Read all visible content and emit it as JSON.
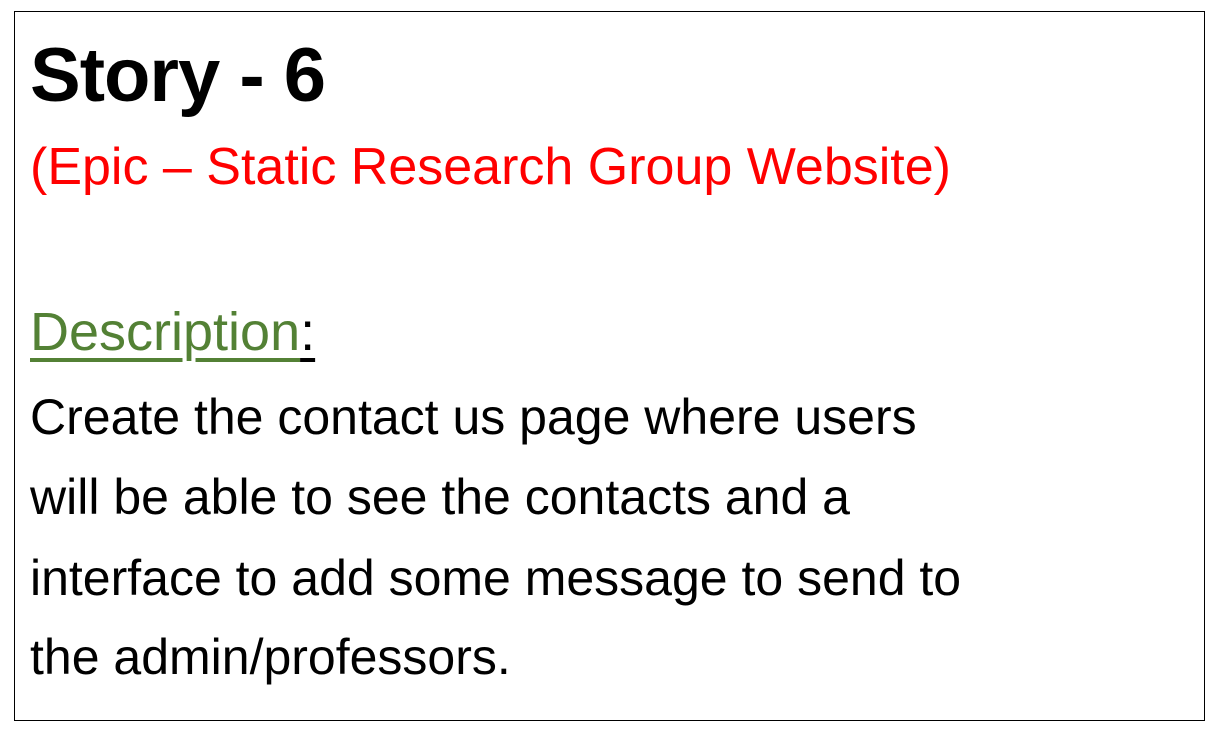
{
  "title": "Story - 6",
  "epic": "(Epic – Static Research Group Website)",
  "description_label": "Description",
  "description_colon": ":",
  "description_lines": [
    "Create the contact us page where users",
    "will be able to see the contacts and a",
    "interface to add some message to send to",
    "the admin/professors."
  ],
  "colors": {
    "title": "#000000",
    "epic": "#ff0000",
    "description_label": "#538135"
  }
}
